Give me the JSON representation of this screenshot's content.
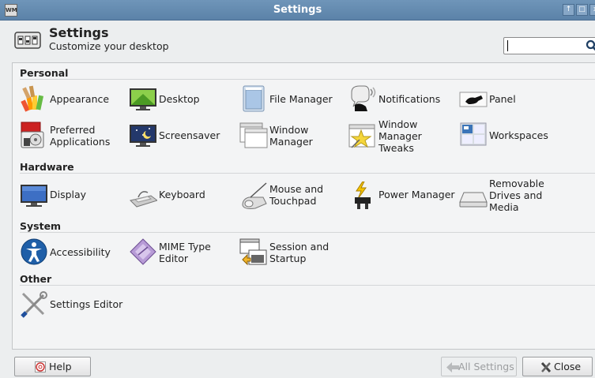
{
  "window": {
    "wm_icon": "WM",
    "title": "Settings",
    "buttons": [
      "↑",
      "□",
      "x"
    ]
  },
  "header": {
    "title": "Settings",
    "subtitle": "Customize your desktop"
  },
  "search": {
    "value": "",
    "placeholder": "",
    "icon": "search-icon"
  },
  "sections": [
    {
      "title": "Personal",
      "items": [
        {
          "label": "Appearance",
          "icon": "appearance-icon"
        },
        {
          "label": "Desktop",
          "icon": "desktop-icon"
        },
        {
          "label": "File Manager",
          "icon": "file-manager-icon"
        },
        {
          "label": "Notifications",
          "icon": "notifications-icon"
        },
        {
          "label": "Panel",
          "icon": "panel-icon"
        },
        {
          "label": "Preferred\nApplications",
          "icon": "preferred-applications-icon"
        },
        {
          "label": "Screensaver",
          "icon": "screensaver-icon"
        },
        {
          "label": "Window\nManager",
          "icon": "window-manager-icon"
        },
        {
          "label": "Window\nManager\nTweaks",
          "icon": "window-manager-tweaks-icon"
        },
        {
          "label": "Workspaces",
          "icon": "workspaces-icon"
        }
      ]
    },
    {
      "title": "Hardware",
      "items": [
        {
          "label": "Display",
          "icon": "display-icon"
        },
        {
          "label": "Keyboard",
          "icon": "keyboard-icon"
        },
        {
          "label": "Mouse and\nTouchpad",
          "icon": "mouse-icon"
        },
        {
          "label": "Power Manager",
          "icon": "power-manager-icon"
        },
        {
          "label": "Removable\nDrives and\nMedia",
          "icon": "removable-drives-icon"
        }
      ]
    },
    {
      "title": "System",
      "items": [
        {
          "label": "Accessibility",
          "icon": "accessibility-icon"
        },
        {
          "label": "MIME Type\nEditor",
          "icon": "mime-type-icon"
        },
        {
          "label": "Session and\nStartup",
          "icon": "session-startup-icon"
        }
      ]
    },
    {
      "title": "Other",
      "items": [
        {
          "label": "Settings Editor",
          "icon": "settings-editor-icon"
        }
      ]
    }
  ],
  "footer": {
    "help_label": "Help",
    "all_settings_label": "All Settings",
    "close_label": "Close"
  }
}
